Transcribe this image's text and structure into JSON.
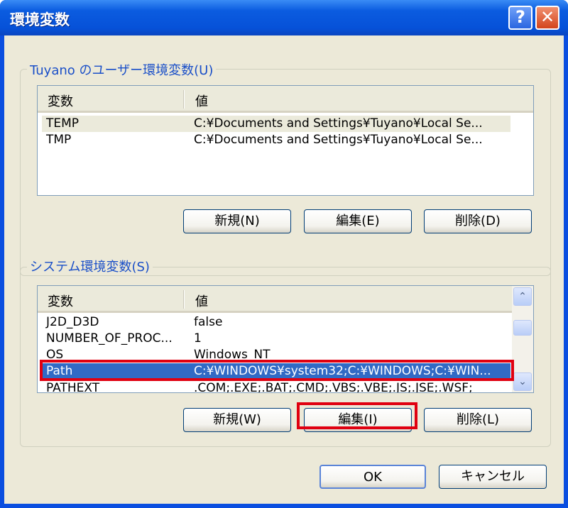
{
  "window": {
    "title": "環境変数",
    "help_icon": "?",
    "close_icon": "✕"
  },
  "user_group": {
    "label": "Tuyano のユーザー環境変数(U)",
    "columns": [
      "変数",
      "値"
    ],
    "rows": [
      {
        "name": "TEMP",
        "value": "C:¥Documents and Settings¥Tuyano¥Local Se..."
      },
      {
        "name": "TMP",
        "value": "C:¥Documents and Settings¥Tuyano¥Local Se..."
      }
    ],
    "buttons": {
      "new": "新規(N)",
      "edit": "編集(E)",
      "delete": "削除(D)"
    }
  },
  "system_group": {
    "label": "システム環境変数(S)",
    "columns": [
      "変数",
      "値"
    ],
    "rows": [
      {
        "name": "J2D_D3D",
        "value": "false"
      },
      {
        "name": "NUMBER_OF_PROC...",
        "value": "1"
      },
      {
        "name": "OS",
        "value": "Windows_NT"
      },
      {
        "name": "Path",
        "value": "C:¥WINDOWS¥system32;C:¥WINDOWS;C:¥WIN..."
      },
      {
        "name": "PATHEXT",
        "value": ".COM;.EXE;.BAT;.CMD;.VBS;.VBE;.JS;.JSE;.WSF;"
      }
    ],
    "buttons": {
      "new": "新規(W)",
      "edit": "編集(I)",
      "delete": "削除(L)"
    },
    "scroll_up": "⌃",
    "scroll_down": "⌄"
  },
  "footer": {
    "ok": "OK",
    "cancel": "キャンセル"
  },
  "colors": {
    "selection": "#316ac5",
    "annotation": "#e00010"
  }
}
